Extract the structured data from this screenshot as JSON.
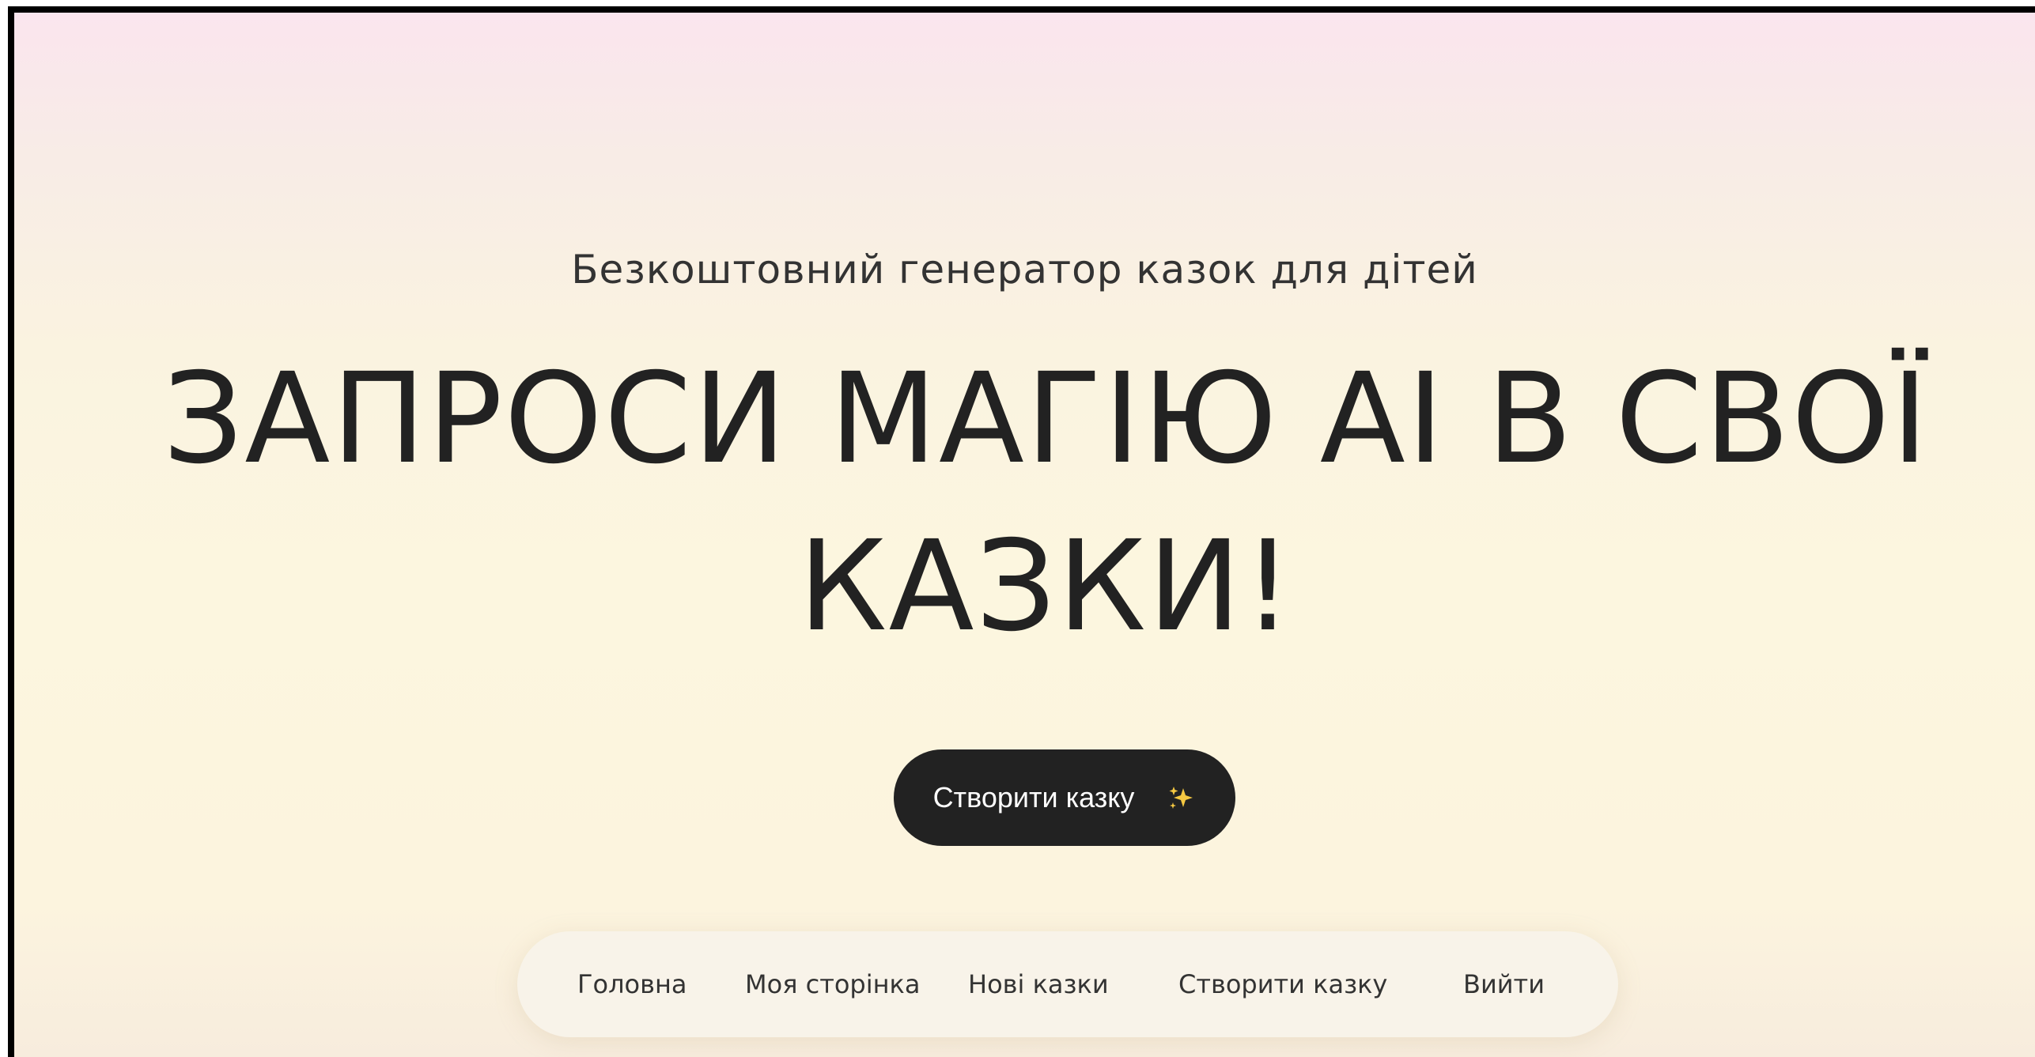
{
  "hero": {
    "subtitle": "Безкоштовний генератор казок для дітей",
    "headline": "ЗАПРОСИ МАГІЮ AI В СВОЇ КАЗКИ!",
    "cta_label": "Створити казку",
    "cta_icon": "sparkles-icon"
  },
  "nav": {
    "items": [
      {
        "label": "Головна"
      },
      {
        "label": "Моя сторінка"
      },
      {
        "label": "Нові казки"
      },
      {
        "label": "Створити казку"
      },
      {
        "label": "Вийти"
      }
    ]
  },
  "colors": {
    "text": "#222222",
    "button_bg": "#222222",
    "button_text": "#ffffff",
    "sparkle": "#f5c842",
    "nav_bg": "#f8f3e9",
    "gradient_top": "#fae5ee",
    "gradient_mid": "#fcf6df"
  }
}
